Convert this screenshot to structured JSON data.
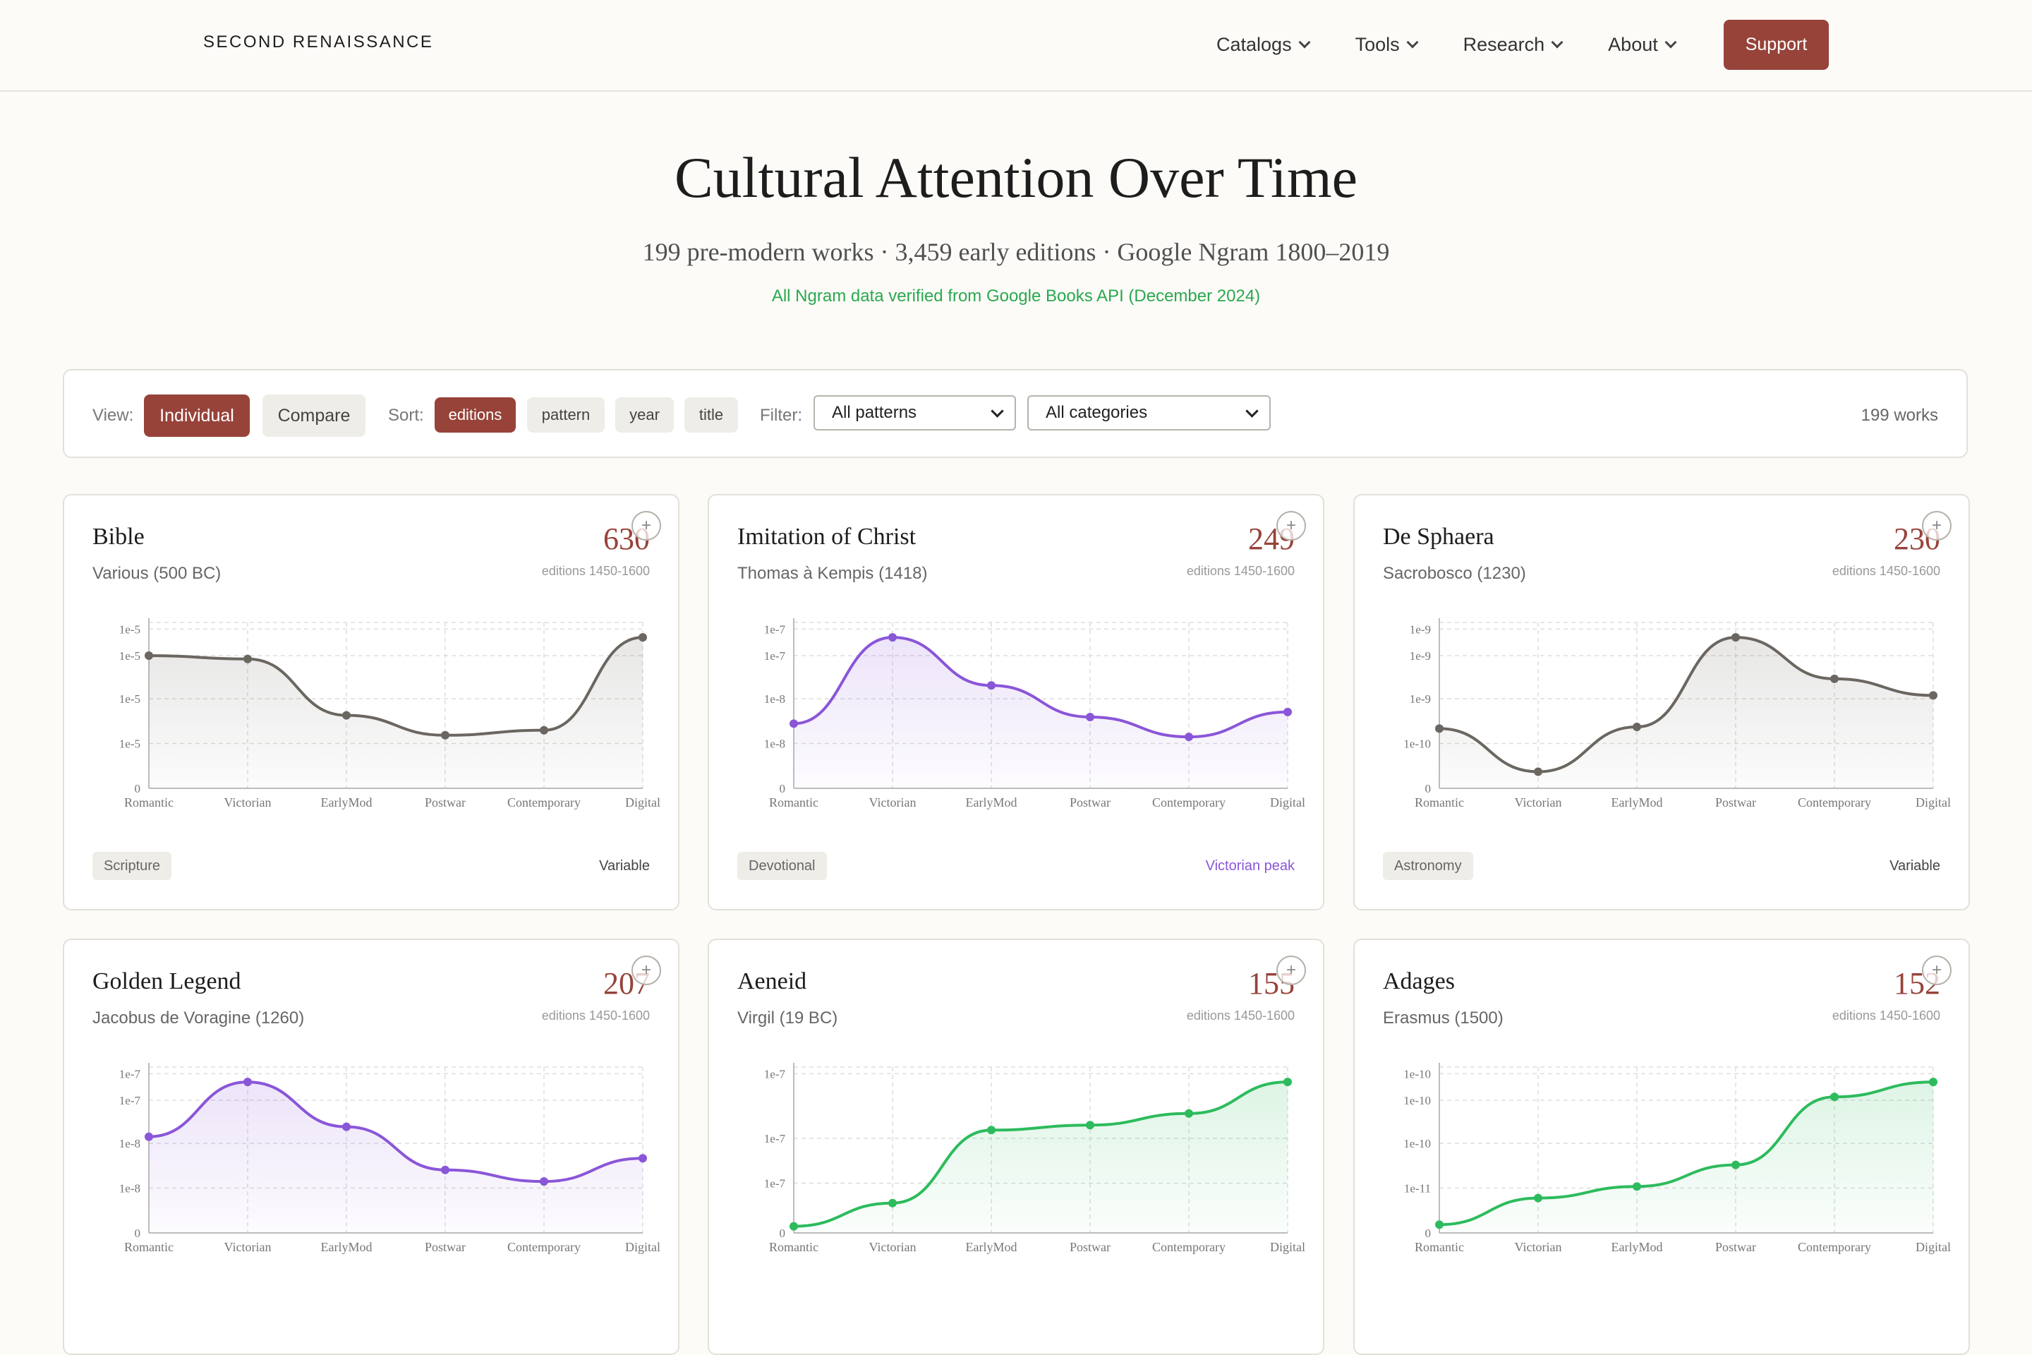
{
  "nav": {
    "brand": "SECOND RENAISSANCE",
    "links": [
      "Catalogs",
      "Tools",
      "Research",
      "About"
    ],
    "support": "Support"
  },
  "hero": {
    "title": "Cultural Attention Over Time",
    "subtitle": "199 pre-modern works · 3,459 early editions · Google Ngram 1800–2019",
    "verified": "All Ngram data verified from Google Books API (December 2024)"
  },
  "toolbar": {
    "view_label": "View:",
    "view_options": [
      "Individual",
      "Compare"
    ],
    "sort_label": "Sort:",
    "sort_options": [
      "editions",
      "pattern",
      "year",
      "title"
    ],
    "filter_label": "Filter:",
    "filter_pattern": "All patterns",
    "filter_category": "All categories",
    "works_count": "199 works"
  },
  "colors": {
    "accent": "#97433a",
    "variable": "#6b6660",
    "victorian": "#8a56d8",
    "rising": "#2dbb5d"
  },
  "cards": [
    {
      "title": "Bible",
      "author": "Various (500 BC)",
      "editions": "630",
      "editions_label": "editions 1450-1600",
      "category": "Scripture",
      "pattern": "Variable",
      "color": "#6b6660"
    },
    {
      "title": "Imitation of Christ",
      "author": "Thomas à Kempis (1418)",
      "editions": "249",
      "editions_label": "editions 1450-1600",
      "category": "Devotional",
      "pattern": "Victorian peak",
      "color": "#8a56d8"
    },
    {
      "title": "De Sphaera",
      "author": "Sacrobosco (1230)",
      "editions": "230",
      "editions_label": "editions 1450-1600",
      "category": "Astronomy",
      "pattern": "Variable",
      "color": "#6b6660"
    },
    {
      "title": "Golden Legend",
      "author": "Jacobus de Voragine (1260)",
      "editions": "207",
      "editions_label": "editions 1450-1600",
      "category": "",
      "pattern": "",
      "color": "#8a56d8"
    },
    {
      "title": "Aeneid",
      "author": "Virgil (19 BC)",
      "editions": "155",
      "editions_label": "editions 1450-1600",
      "category": "",
      "pattern": "",
      "color": "#2dbb5d"
    },
    {
      "title": "Adages",
      "author": "Erasmus (1500)",
      "editions": "152",
      "editions_label": "editions 1450-1600",
      "category": "",
      "pattern": "",
      "color": "#2dbb5d"
    }
  ],
  "chart_data": [
    {
      "type": "area",
      "title": "Bible",
      "x": [
        "Romantic",
        "Victorian",
        "EarlyMod",
        "Postwar",
        "Contemporary",
        "Digital"
      ],
      "y_ticks": [
        "1e-5",
        "1e-5",
        "1e-5",
        "1e-5",
        "0"
      ],
      "values": [
        0.8,
        0.78,
        0.44,
        0.32,
        0.35,
        0.91
      ],
      "ylim": [
        0,
        1
      ]
    },
    {
      "type": "area",
      "title": "Imitation of Christ",
      "x": [
        "Romantic",
        "Victorian",
        "EarlyMod",
        "Postwar",
        "Contemporary",
        "Digital"
      ],
      "y_ticks": [
        "1e-7",
        "1e-7",
        "1e-8",
        "1e-8",
        "0"
      ],
      "values": [
        0.39,
        0.91,
        0.62,
        0.43,
        0.31,
        0.46
      ],
      "ylim": [
        0,
        1
      ]
    },
    {
      "type": "area",
      "title": "De Sphaera",
      "x": [
        "Romantic",
        "Victorian",
        "EarlyMod",
        "Postwar",
        "Contemporary",
        "Digital"
      ],
      "y_ticks": [
        "1e-9",
        "1e-9",
        "1e-9",
        "1e-10",
        "0"
      ],
      "values": [
        0.36,
        0.1,
        0.37,
        0.91,
        0.66,
        0.56
      ],
      "ylim": [
        0,
        1
      ]
    },
    {
      "type": "area",
      "title": "Golden Legend",
      "x": [
        "Romantic",
        "Victorian",
        "EarlyMod",
        "Postwar",
        "Contemporary",
        "Digital"
      ],
      "y_ticks": [
        "1e-7",
        "1e-7",
        "1e-8",
        "1e-8",
        "0"
      ],
      "values": [
        0.58,
        0.91,
        0.64,
        0.38,
        0.31,
        0.45
      ],
      "ylim": [
        0,
        1
      ]
    },
    {
      "type": "area",
      "title": "Aeneid",
      "x": [
        "Romantic",
        "Victorian",
        "EarlyMod",
        "Postwar",
        "Contemporary",
        "Digital"
      ],
      "y_ticks": [
        "1e-7",
        "1e-7",
        "1e-7",
        "0"
      ],
      "values": [
        0.04,
        0.18,
        0.62,
        0.65,
        0.72,
        0.91
      ],
      "ylim": [
        0,
        1
      ]
    },
    {
      "type": "area",
      "title": "Adages",
      "x": [
        "Romantic",
        "Victorian",
        "EarlyMod",
        "Postwar",
        "Contemporary",
        "Digital"
      ],
      "y_ticks": [
        "1e-10",
        "1e-10",
        "1e-10",
        "1e-11",
        "0"
      ],
      "values": [
        0.05,
        0.21,
        0.28,
        0.41,
        0.82,
        0.91
      ],
      "ylim": [
        0,
        1
      ]
    }
  ]
}
